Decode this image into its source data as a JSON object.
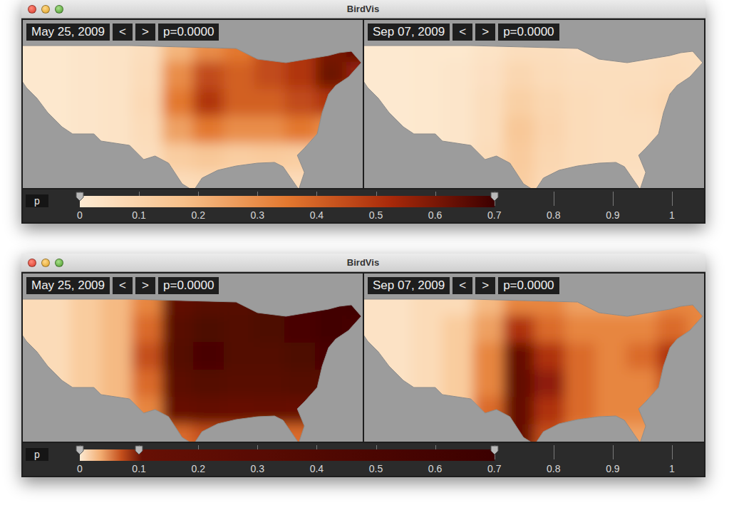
{
  "windows": [
    {
      "title": "BirdVis",
      "maps": [
        {
          "date": "May 25, 2009",
          "prev": "<",
          "next": ">",
          "p": "p=0.0000",
          "grid": [
            [
              0.01,
              0.01,
              0.02,
              0.03,
              0.05,
              0.2,
              0.3,
              0.35,
              0.45,
              0.5,
              0.6,
              0.65
            ],
            [
              0.01,
              0.01,
              0.02,
              0.03,
              0.06,
              0.3,
              0.45,
              0.4,
              0.45,
              0.5,
              0.62,
              0.55
            ],
            [
              0.01,
              0.01,
              0.02,
              0.03,
              0.07,
              0.35,
              0.5,
              0.4,
              0.4,
              0.45,
              0.5,
              0.4
            ],
            [
              0.01,
              0.01,
              0.02,
              0.03,
              0.06,
              0.25,
              0.35,
              0.3,
              0.3,
              0.35,
              0.3,
              0.3
            ],
            [
              0.01,
              0.01,
              0.02,
              0.03,
              0.05,
              0.12,
              0.14,
              0.12,
              0.13,
              0.12,
              0.1,
              0.1
            ],
            [
              0.01,
              0.01,
              0.02,
              0.03,
              0.04,
              0.06,
              0.07,
              0.07,
              0.06,
              0.06,
              0.06,
              0.05
            ]
          ]
        },
        {
          "date": "Sep 07, 2009",
          "prev": "<",
          "next": ">",
          "p": "p=0.0000",
          "grid": [
            [
              0.005,
              0.005,
              0.01,
              0.01,
              0.03,
              0.05,
              0.05,
              0.04,
              0.04,
              0.04,
              0.05,
              0.05
            ],
            [
              0.005,
              0.005,
              0.01,
              0.02,
              0.04,
              0.08,
              0.06,
              0.05,
              0.05,
              0.05,
              0.06,
              0.05
            ],
            [
              0.005,
              0.005,
              0.01,
              0.02,
              0.05,
              0.11,
              0.08,
              0.06,
              0.05,
              0.06,
              0.08,
              0.07
            ],
            [
              0.005,
              0.005,
              0.01,
              0.02,
              0.05,
              0.14,
              0.09,
              0.06,
              0.05,
              0.05,
              0.07,
              0.05
            ],
            [
              0.005,
              0.005,
              0.01,
              0.02,
              0.06,
              0.13,
              0.08,
              0.06,
              0.05,
              0.05,
              0.04,
              0.04
            ],
            [
              0.005,
              0.005,
              0.01,
              0.02,
              0.05,
              0.12,
              0.07,
              0.05,
              0.04,
              0.04,
              0.04,
              0.05
            ]
          ]
        }
      ],
      "colorbar": {
        "label": "p",
        "handles": [
          {
            "level": 0
          },
          {
            "level": 0.7
          }
        ],
        "ticks": [
          "0",
          "0.1",
          "0.2",
          "0.3",
          "0.4",
          "0.5",
          "0.6",
          "0.7",
          "0.8",
          "0.9",
          "1"
        ]
      }
    },
    {
      "title": "BirdVis",
      "maps": [
        {
          "date": "May 25, 2009",
          "prev": "<",
          "next": ">",
          "p": "p=0.0000",
          "grid": [
            [
              0.01,
              0.01,
              0.02,
              0.03,
              0.05,
              0.2,
              0.3,
              0.35,
              0.45,
              0.5,
              0.6,
              0.65
            ],
            [
              0.01,
              0.01,
              0.02,
              0.03,
              0.06,
              0.3,
              0.45,
              0.4,
              0.45,
              0.5,
              0.62,
              0.55
            ],
            [
              0.01,
              0.01,
              0.02,
              0.03,
              0.07,
              0.35,
              0.5,
              0.4,
              0.4,
              0.45,
              0.5,
              0.4
            ],
            [
              0.01,
              0.01,
              0.02,
              0.03,
              0.06,
              0.25,
              0.35,
              0.3,
              0.3,
              0.35,
              0.3,
              0.3
            ],
            [
              0.01,
              0.01,
              0.02,
              0.03,
              0.05,
              0.12,
              0.14,
              0.12,
              0.13,
              0.12,
              0.1,
              0.1
            ],
            [
              0.01,
              0.01,
              0.02,
              0.03,
              0.04,
              0.06,
              0.07,
              0.07,
              0.06,
              0.06,
              0.06,
              0.05
            ]
          ]
        },
        {
          "date": "Sep 07, 2009",
          "prev": "<",
          "next": ">",
          "p": "p=0.0000",
          "grid": [
            [
              0.005,
              0.005,
              0.01,
              0.01,
              0.03,
              0.05,
              0.05,
              0.04,
              0.04,
              0.04,
              0.05,
              0.05
            ],
            [
              0.005,
              0.005,
              0.01,
              0.02,
              0.04,
              0.08,
              0.06,
              0.05,
              0.05,
              0.05,
              0.06,
              0.05
            ],
            [
              0.005,
              0.005,
              0.01,
              0.02,
              0.05,
              0.11,
              0.08,
              0.06,
              0.05,
              0.06,
              0.08,
              0.07
            ],
            [
              0.005,
              0.005,
              0.01,
              0.02,
              0.05,
              0.14,
              0.09,
              0.06,
              0.05,
              0.05,
              0.07,
              0.05
            ],
            [
              0.005,
              0.005,
              0.01,
              0.02,
              0.06,
              0.13,
              0.08,
              0.06,
              0.05,
              0.05,
              0.04,
              0.04
            ],
            [
              0.005,
              0.005,
              0.01,
              0.02,
              0.05,
              0.12,
              0.07,
              0.05,
              0.04,
              0.04,
              0.04,
              0.05
            ]
          ]
        }
      ],
      "colorbar": {
        "label": "p",
        "handles": [
          {
            "level": 0
          },
          {
            "level": 0.1
          },
          {
            "level": 0.7
          }
        ],
        "ticks": [
          "0",
          "0.1",
          "0.2",
          "0.3",
          "0.4",
          "0.5",
          "0.6",
          "0.7",
          "0.8",
          "0.9",
          "1"
        ]
      }
    }
  ]
}
